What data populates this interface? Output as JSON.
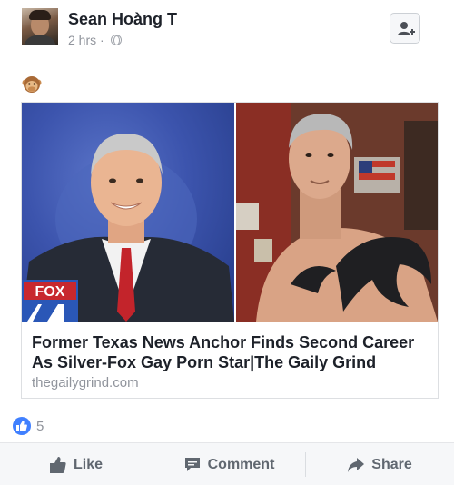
{
  "post": {
    "author": "Sean Hoàng T",
    "time": "2 hrs",
    "time_separator": "·",
    "privacy_icon": "globe-icon",
    "emoji": "🙊"
  },
  "link_card": {
    "title": "Former Texas News Anchor Finds Second Career As Silver-Fox Gay Porn Star|The Gaily Grind",
    "domain": "thegailygrind.com",
    "image_logo_text": "FOX"
  },
  "reactions": {
    "icon": "like-reaction-icon",
    "count": "5"
  },
  "actions": {
    "like": "Like",
    "comment": "Comment",
    "share": "Share"
  },
  "colors": {
    "link_blue": "#4080ff",
    "text_primary": "#1d2129",
    "text_secondary": "#90949c",
    "action_gray": "#606770"
  }
}
